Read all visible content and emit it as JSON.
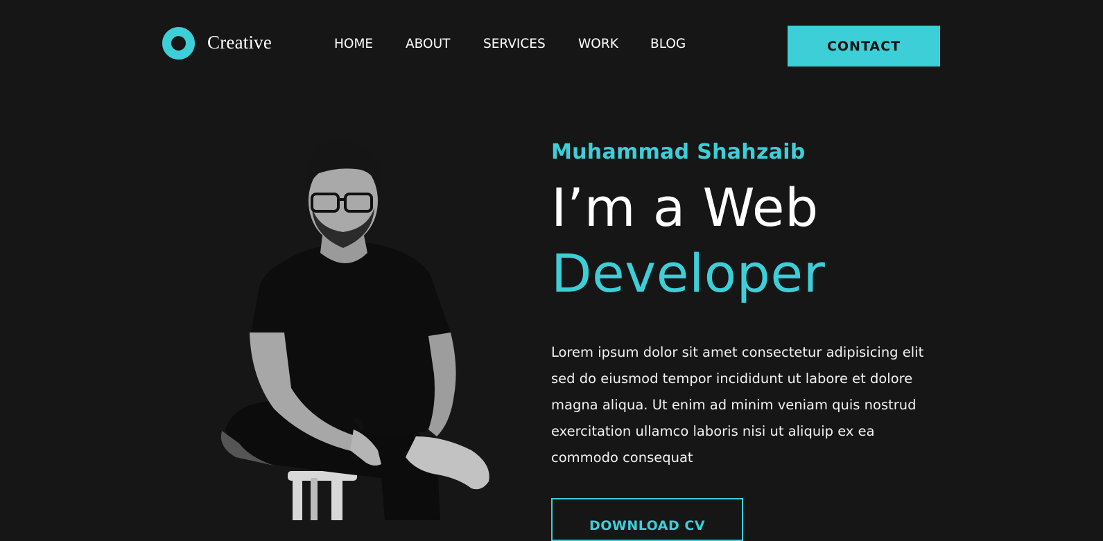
{
  "brand": {
    "logo_icon": "ring-logo-icon",
    "name": "Creative"
  },
  "nav": {
    "items": [
      {
        "label": "HOME"
      },
      {
        "label": "ABOUT"
      },
      {
        "label": "SERVICES"
      },
      {
        "label": "WORK"
      },
      {
        "label": "BLOG"
      }
    ]
  },
  "header": {
    "contact_label": "CONTACT"
  },
  "hero": {
    "name": "Muhammad Shahzaib",
    "line1": "I’m a Web",
    "line2": "Developer",
    "description": "Lorem ipsum dolor sit amet consectetur adipisicing elit sed do eiusmod tempor incididunt ut labore et dolore magna aliqua. Ut enim ad minim veniam quis nostrud exercitation ullamco laboris nisi ut aliquip ex ea commodo consequat",
    "download_label": "DOWNLOAD CV",
    "portrait_icon": "person-sitting-on-stool-icon"
  },
  "colors": {
    "background": "#161616",
    "accent": "#3ccfd8",
    "text": "#ffffff"
  }
}
